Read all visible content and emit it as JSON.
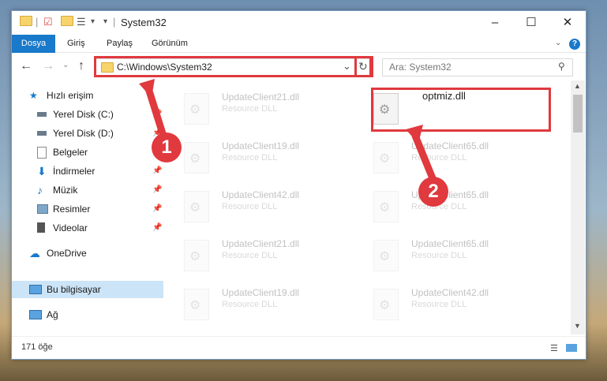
{
  "window": {
    "title": "System32"
  },
  "ribbon": {
    "tabs": [
      "Dosya",
      "Giriş",
      "Paylaş",
      "Görünüm"
    ]
  },
  "address": {
    "path": "C:\\Windows\\System32",
    "dropdown": "⌄",
    "refresh": "↻"
  },
  "search": {
    "placeholder": "Ara: System32"
  },
  "sidebar": {
    "items": [
      {
        "label": "Hızlı erişim"
      },
      {
        "label": "Yerel Disk (C:)"
      },
      {
        "label": "Yerel Disk (D:)"
      },
      {
        "label": "Belgeler"
      },
      {
        "label": "İndirmeler"
      },
      {
        "label": "Müzik"
      },
      {
        "label": "Resimler"
      },
      {
        "label": "Videolar"
      },
      {
        "label": "OneDrive"
      },
      {
        "label": "Bu bilgisayar"
      },
      {
        "label": "Ağ"
      }
    ]
  },
  "files": [
    {
      "name": "UpdateClient21.dll",
      "type": "Resource DLL"
    },
    {
      "name": "optmiz.dll",
      "type": ""
    },
    {
      "name": "UpdateClient19.dll",
      "type": "Resource DLL"
    },
    {
      "name": "UpdateClient65.dll",
      "type": "Resource DLL"
    },
    {
      "name": "UpdateClient42.dll",
      "type": "Resource DLL"
    },
    {
      "name": "UpdateClient65.dll",
      "type": "Resource DLL"
    },
    {
      "name": "UpdateClient21.dll",
      "type": "Resource DLL"
    },
    {
      "name": "UpdateClient65.dll",
      "type": "Resource DLL"
    },
    {
      "name": "UpdateClient19.dll",
      "type": "Resource DLL"
    },
    {
      "name": "UpdateClient42.dll",
      "type": "Resource DLL"
    }
  ],
  "status": {
    "count": "171 öğe"
  },
  "annotations": {
    "step1": "1",
    "step2": "2"
  },
  "colors": {
    "accent": "#1979ca",
    "highlight": "#e0393e",
    "selected": "#cce4f7"
  }
}
